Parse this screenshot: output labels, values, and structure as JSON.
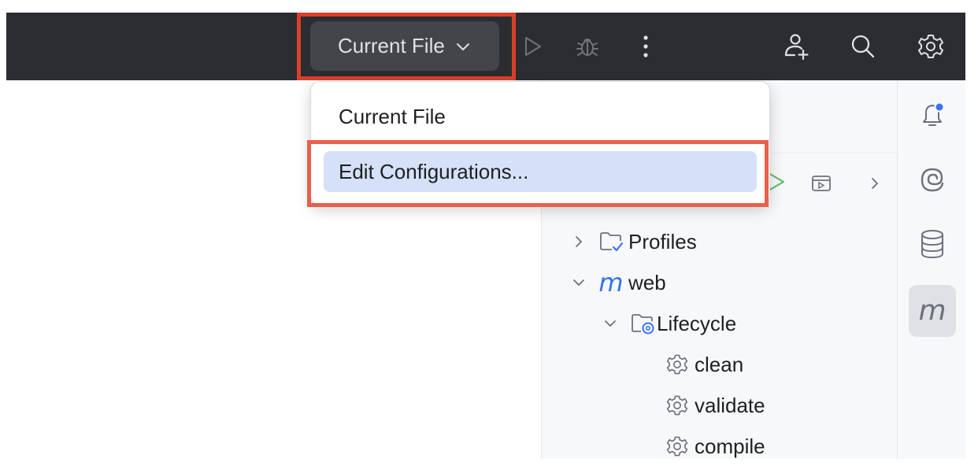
{
  "toolbar": {
    "run_config_label": "Current File",
    "icons": [
      "run-icon",
      "debug-icon",
      "more-icon",
      "add-user-icon",
      "search-icon",
      "settings-icon"
    ]
  },
  "popup": {
    "items": [
      {
        "label": "Current File",
        "selected": false
      },
      {
        "label": "Edit Configurations...",
        "selected": true
      }
    ]
  },
  "maven_panel": {
    "toolbar_icons": [
      "run-icon",
      "run-config-icon",
      "chevron-right-icon"
    ],
    "tree": [
      {
        "label": "Profiles",
        "icon": "folder-check-icon",
        "expanded": false,
        "level": 0
      },
      {
        "label": "web",
        "icon": "maven-icon",
        "icon_text": "m",
        "expanded": true,
        "level": 0
      },
      {
        "label": "Lifecycle",
        "icon": "folder-gear-icon",
        "expanded": true,
        "level": 1
      },
      {
        "label": "clean",
        "icon": "gear-icon",
        "level": 2
      },
      {
        "label": "validate",
        "icon": "gear-icon",
        "level": 2
      },
      {
        "label": "compile",
        "icon": "gear-icon",
        "level": 2
      }
    ]
  },
  "right_strip": {
    "buttons": [
      {
        "icon": "notifications-icon",
        "active": false
      },
      {
        "icon": "ai-assistant-icon",
        "active": false
      },
      {
        "icon": "database-icon",
        "active": false
      },
      {
        "icon": "maven-icon",
        "icon_text": "m",
        "active": true
      }
    ]
  },
  "colors": {
    "toolbar_bg": "#2b2d30",
    "highlight": "#d9402b",
    "accent": "#3574f0",
    "selected_item": "#d5e1f8",
    "run_green": "#5fb865"
  }
}
